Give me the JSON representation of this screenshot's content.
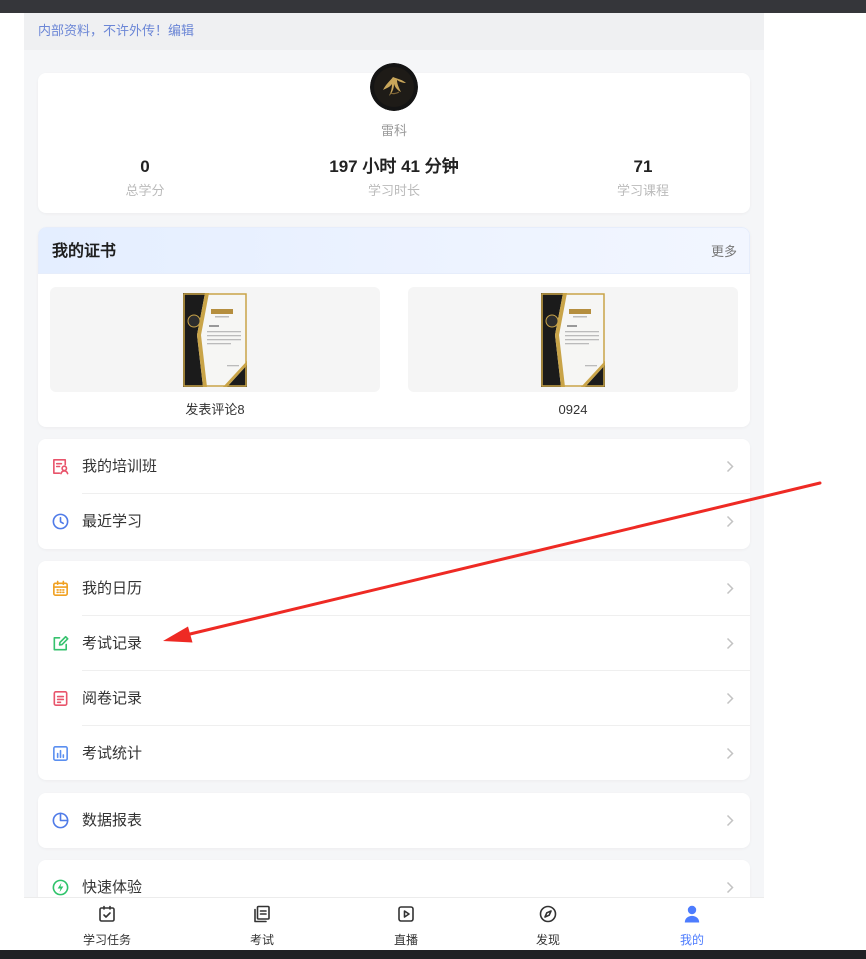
{
  "notice": {
    "text": "内部资料，不许外传！",
    "edit_link": "编辑"
  },
  "profile": {
    "avatar_icon": "avatar-image",
    "name": "雷科",
    "stats": [
      {
        "value": "0",
        "label": "总学分"
      },
      {
        "value": "197 小时 41 分钟",
        "label": "学习时长"
      },
      {
        "value": "71",
        "label": "学习课程"
      }
    ]
  },
  "certificates": {
    "title": "我的证书",
    "more": "更多",
    "items": [
      {
        "name": "发表评论8",
        "icon": "certificate-thumbnail"
      },
      {
        "name": "0924",
        "icon": "certificate-thumbnail"
      }
    ]
  },
  "menu_groups": [
    {
      "items": [
        {
          "label": "我的培训班",
          "icon": "training-class-icon",
          "color": "#e8546b"
        },
        {
          "label": "最近学习",
          "icon": "clock-icon",
          "color": "#4f7be8"
        }
      ]
    },
    {
      "items": [
        {
          "label": "我的日历",
          "icon": "calendar-icon",
          "color": "#f0a020"
        },
        {
          "label": "考试记录",
          "icon": "edit-record-icon",
          "color": "#36c26e"
        },
        {
          "label": "阅卷记录",
          "icon": "document-icon",
          "color": "#e8546b"
        },
        {
          "label": "考试统计",
          "icon": "bar-chart-icon",
          "color": "#5b8ff0"
        }
      ]
    },
    {
      "items": [
        {
          "label": "数据报表",
          "icon": "pie-chart-icon",
          "color": "#4f7be8"
        }
      ]
    },
    {
      "items": [
        {
          "label": "快速体验",
          "icon": "lightning-icon",
          "color": "#2ec36a"
        }
      ]
    }
  ],
  "bottom_nav": {
    "items": [
      {
        "label": "学习任务",
        "icon": "task-check-icon"
      },
      {
        "label": "考试",
        "icon": "exam-icon"
      },
      {
        "label": "直播",
        "icon": "live-play-icon"
      },
      {
        "label": "发现",
        "icon": "compass-icon"
      },
      {
        "label": "我的",
        "icon": "user-icon"
      }
    ],
    "active_index": 4
  },
  "colors": {
    "accent": "#4d7cfe",
    "notice": "#6b86d6",
    "annotation_arrow": "#ee2a24",
    "page_background": "#f5f6f8"
  }
}
